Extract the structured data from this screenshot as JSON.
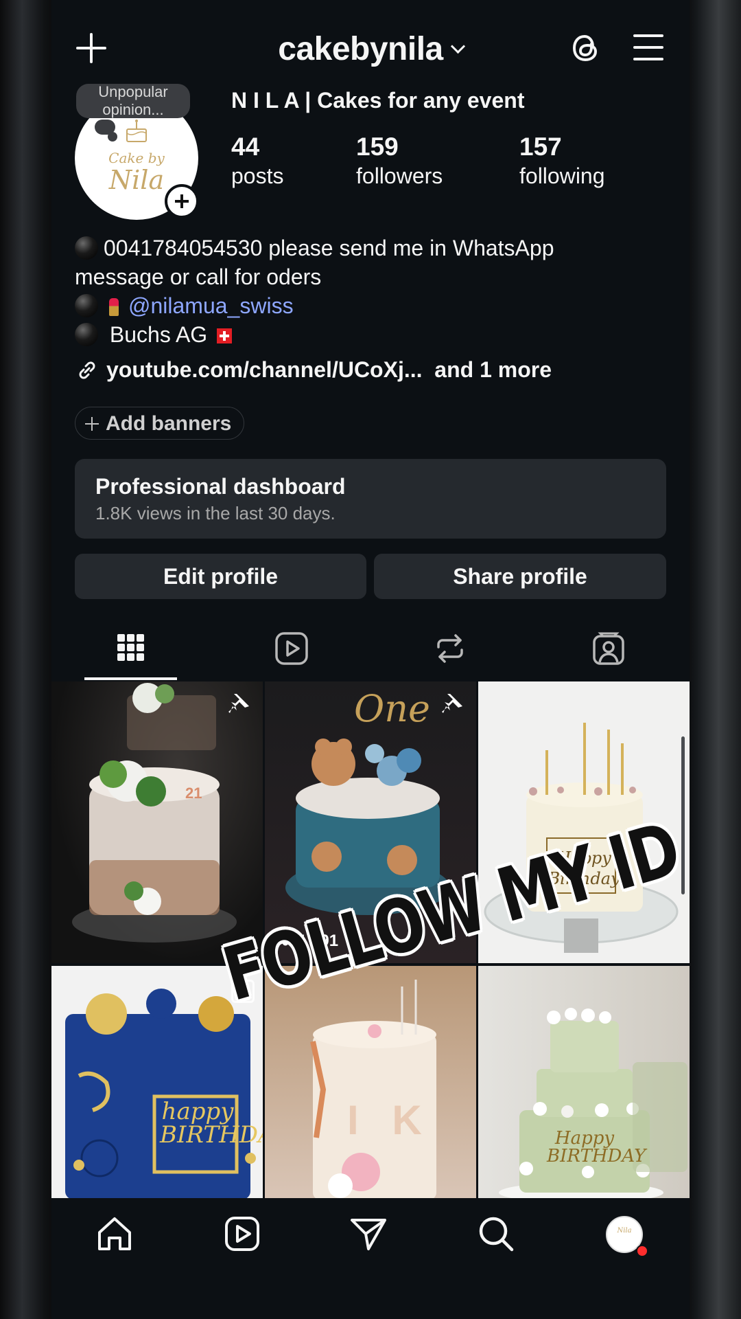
{
  "header": {
    "username": "cakebynila"
  },
  "profile": {
    "note": "Unpopular opinion...",
    "avatar_logo_line1": "Cake by",
    "avatar_logo_line2": "Nila",
    "full_name": "N I L A | Cakes for any event",
    "stats": {
      "posts": {
        "count": "44",
        "label": "posts"
      },
      "followers": {
        "count": "159",
        "label": "followers"
      },
      "following": {
        "count": "157",
        "label": "following"
      }
    },
    "bio": {
      "line1": "0041784054530 please send me in WhatsApp",
      "line2": "message or call for  oders",
      "mention": "@nilamua_swiss",
      "location": "Buchs AG"
    },
    "link_text": "youtube.com/channel/UCoXj...",
    "link_more": "and 1 more",
    "add_banners": "Add banners"
  },
  "dashboard": {
    "title": "Professional dashboard",
    "subtitle": "1.8K views in the last 30 days."
  },
  "actions": {
    "edit_profile": "Edit profile",
    "share_profile": "Share profile"
  },
  "tabs": [
    "posts-grid",
    "reels",
    "reposts",
    "tagged"
  ],
  "grid": [
    {
      "pinned": true,
      "label": "21",
      "theme": "naked cake with white flowers"
    },
    {
      "pinned": true,
      "label": "One",
      "views": "1'391",
      "theme": "teddy bear blue cake"
    },
    {
      "pinned": false,
      "label": "Happy Birthday",
      "theme": "white cake with gold candles"
    },
    {
      "pinned": false,
      "label": "happy BIRTHDAY",
      "theme": "blue and gold cake"
    },
    {
      "pinned": false,
      "label": "I K",
      "theme": "white cake with pink flowers"
    },
    {
      "pinned": false,
      "label": "Happy BIRTHDAY",
      "theme": "sage green tiered cake"
    }
  ],
  "overlay_text": "FOLLOW MY ID",
  "bottom_nav": [
    "home-icon",
    "reels-icon",
    "direct-icon",
    "search-icon",
    "profile-avatar"
  ],
  "colors": {
    "background": "#0c1014",
    "card": "#25292e",
    "mention": "#8ea7ff",
    "notification": "#ff2d2d"
  }
}
